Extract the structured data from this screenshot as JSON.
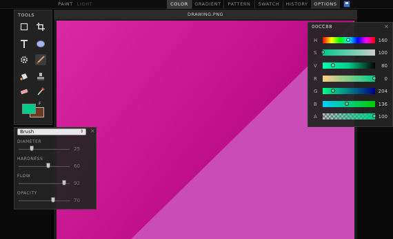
{
  "topbar": {
    "modes": [
      "PAINT",
      "LIGHT"
    ],
    "tabs": [
      "COLOR",
      "GRADIENT",
      "PATTERN",
      "SWATCH",
      "HISTORY",
      "OPTIONS"
    ],
    "active_tab": "COLOR",
    "save_icon": "save-icon"
  },
  "document": {
    "title": "DRAWING.PNG",
    "colors": {
      "dark_magenta": "#d92aa4",
      "light_magenta": "#c94db4"
    }
  },
  "tools_panel": {
    "title": "TOOLS",
    "tools": [
      "selection-icon",
      "crop-icon",
      "text-icon",
      "ellipse-icon",
      "gear-icon",
      "brush-icon",
      "fill-icon",
      "stamp-icon",
      "eraser-icon",
      "eyedropper-icon"
    ],
    "selected_tool": "brush-icon",
    "foreground_color": "#00cc88",
    "background_color": "#6b3a1f",
    "swap_label": "F"
  },
  "brush_panel": {
    "preset": "Brush",
    "sliders": [
      {
        "label": "DIAMETER",
        "value": "25"
      },
      {
        "label": "HARDNESS",
        "value": "60"
      },
      {
        "label": "FLOW",
        "value": "92"
      },
      {
        "label": "OPACITY",
        "value": "70"
      }
    ]
  },
  "color_panel": {
    "hex": "00CC88",
    "channels": [
      {
        "label": "H",
        "value": "160"
      },
      {
        "label": "S",
        "value": "100"
      },
      {
        "label": "V",
        "value": "80"
      },
      {
        "label": "R",
        "value": "0"
      },
      {
        "label": "G",
        "value": "204"
      },
      {
        "label": "B",
        "value": "136"
      },
      {
        "label": "A",
        "value": "100"
      }
    ]
  }
}
